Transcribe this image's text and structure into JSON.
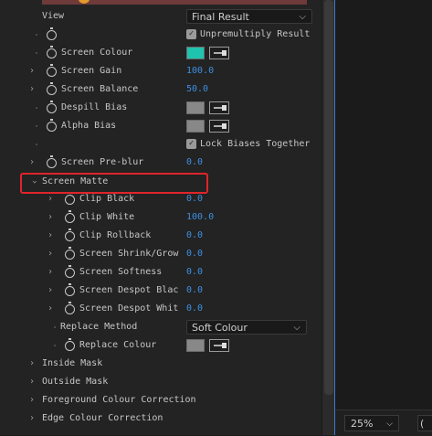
{
  "effect": {
    "view": {
      "label": "View",
      "value": "Final Result"
    },
    "unpremultiply": {
      "label": "Unpremultiply Result",
      "checked": true
    },
    "screen_colour": {
      "label": "Screen Colour",
      "color": "#1fc4ae"
    },
    "screen_gain": {
      "label": "Screen Gain",
      "value": "100.0"
    },
    "screen_balance": {
      "label": "Screen Balance",
      "value": "50.0"
    },
    "despill_bias": {
      "label": "Despill Bias",
      "color": "#888888"
    },
    "alpha_bias": {
      "label": "Alpha Bias",
      "color": "#888888"
    },
    "lock_biases": {
      "label": "Lock Biases Together",
      "checked": true
    },
    "screen_preblur": {
      "label": "Screen Pre-blur",
      "value": "0.0"
    },
    "screen_matte": {
      "label": "Screen Matte",
      "clip_black": {
        "label": "Clip Black",
        "value": "0.0"
      },
      "clip_white": {
        "label": "Clip White",
        "value": "100.0"
      },
      "clip_rollback": {
        "label": "Clip Rollback",
        "value": "0.0"
      },
      "shrink_grow": {
        "label": "Screen Shrink/Grow",
        "value": "0.0"
      },
      "softness": {
        "label": "Screen Softness",
        "value": "0.0"
      },
      "despot_black": {
        "label": "Screen Despot Blac",
        "value": "0.0"
      },
      "despot_white": {
        "label": "Screen Despot Whit",
        "value": "0.0"
      },
      "replace_method": {
        "label": "Replace Method",
        "value": "Soft Colour"
      },
      "replace_colour": {
        "label": "Replace Colour",
        "color": "#888888"
      }
    },
    "inside_mask": {
      "label": "Inside Mask"
    },
    "outside_mask": {
      "label": "Outside Mask"
    },
    "fg_colour_correction": {
      "label": "Foreground Colour Correction"
    },
    "edge_colour_correction": {
      "label": "Edge Colour Correction"
    }
  },
  "viewer": {
    "zoom": "25%",
    "resolution_prefix": "(",
    "accent": "#3c7bd0"
  },
  "colors": {
    "value_blue": "#3d8fe0",
    "highlight_red": "#e0242b"
  }
}
